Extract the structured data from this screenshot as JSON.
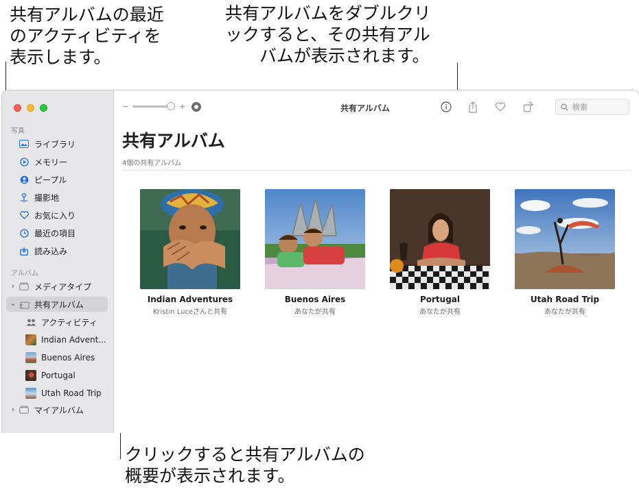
{
  "callouts": {
    "top_left": "共有アルバムの最近\nのアクティビティを\n表示します。",
    "top_right": "共有アルバムをダブルクリ\nックすると、その共有アル\n　　バムが表示されます。",
    "bottom": "クリックすると共有アルバムの\n概要が表示されます。"
  },
  "toolbar": {
    "zoom_minus": "−",
    "zoom_plus": "+",
    "title": "共有アルバム",
    "search_placeholder": "検索"
  },
  "sidebar": {
    "photos_header": "写真",
    "photos_items": [
      {
        "label": "ライブラリ",
        "icon": "photo-library-icon"
      },
      {
        "label": "メモリー",
        "icon": "memories-icon"
      },
      {
        "label": "ピープル",
        "icon": "people-icon"
      },
      {
        "label": "撮影地",
        "icon": "places-icon"
      },
      {
        "label": "お気に入り",
        "icon": "heart-icon"
      },
      {
        "label": "最近の項目",
        "icon": "clock-icon"
      },
      {
        "label": "読み込み",
        "icon": "import-icon"
      }
    ],
    "albums_header": "アルバム",
    "media_types": "メディアタイプ",
    "shared_albums": "共有アルバム",
    "shared_children": [
      {
        "label": "アクティビティ",
        "icon": "activity-icon"
      },
      {
        "label": "Indian Advent...",
        "icon": "album-thumbnail"
      },
      {
        "label": "Buenos Aires",
        "icon": "album-thumbnail"
      },
      {
        "label": "Portugal",
        "icon": "album-thumbnail"
      },
      {
        "label": "Utah Road Trip",
        "icon": "album-thumbnail"
      }
    ],
    "my_albums": "マイアルバム"
  },
  "main": {
    "title": "共有アルバム",
    "subtitle": "4個の共有アルバム",
    "albums": [
      {
        "name": "Indian Adventures",
        "owner": "Kristin Luceさんと共有"
      },
      {
        "name": "Buenos Aires",
        "owner": "あなたが共有"
      },
      {
        "name": "Portugal",
        "owner": "あなたが共有"
      },
      {
        "name": "Utah Road Trip",
        "owner": "あなたが共有"
      }
    ]
  },
  "colors": {
    "accent": "#1e6fe4",
    "sidebar_bg": "#e7e7e9",
    "selected_bg": "#d4d4d7"
  }
}
